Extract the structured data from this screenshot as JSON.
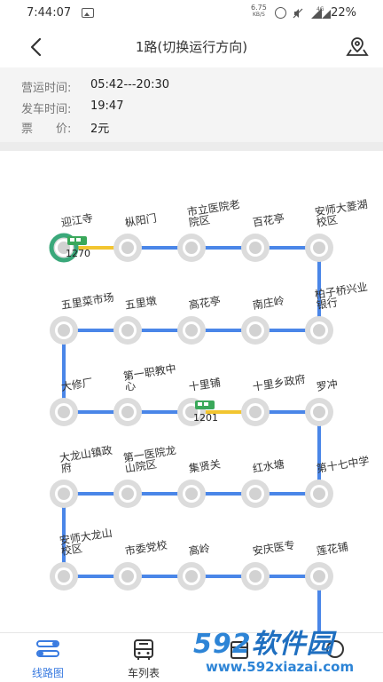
{
  "status_bar": {
    "time": "7:44:07",
    "net_speed": "6.75",
    "net_unit": "KB/S",
    "network": "4G",
    "battery": "22%"
  },
  "header": {
    "title": "1路(切换运行方向)",
    "back_icon": "chevron-left-icon",
    "location_icon": "map-pin-icon"
  },
  "info": {
    "hours_label": "营运时间:",
    "hours_value": "05:42---20:30",
    "depart_label": "发车时间:",
    "depart_value": "19:47",
    "fare_label": "票　　价:",
    "fare_value": "2元"
  },
  "route_map": {
    "colors": {
      "line": "#4a86e8",
      "segment_bus": "#f2c530",
      "start_ring": "#3aa87a",
      "bus": "#3aa85a",
      "node": "#dcdcdc"
    },
    "stations": [
      {
        "name": "迎江寺"
      },
      {
        "name": "枞阳门"
      },
      {
        "name": "市立医院老院区"
      },
      {
        "name": "百花亭"
      },
      {
        "name": "安师大菱湖校区"
      },
      {
        "name": "柏子桥兴业银行"
      },
      {
        "name": "南庄岭"
      },
      {
        "name": "高花亭"
      },
      {
        "name": "五里墩"
      },
      {
        "name": "五里菜市场"
      },
      {
        "name": "大修厂"
      },
      {
        "name": "第一职教中心"
      },
      {
        "name": "十里铺"
      },
      {
        "name": "十里乡政府"
      },
      {
        "name": "罗冲"
      },
      {
        "name": "第十七中学"
      },
      {
        "name": "红水塘"
      },
      {
        "name": "集贤关"
      },
      {
        "name": "第一医院龙山院区"
      },
      {
        "name": "大龙山镇政府"
      },
      {
        "name": "安师大龙山校区"
      },
      {
        "name": "市委党校"
      },
      {
        "name": "高岭"
      },
      {
        "name": "安庆医专"
      },
      {
        "name": "莲花铺"
      }
    ],
    "buses": [
      {
        "label": "1270",
        "station_index": 0
      },
      {
        "label": "1201",
        "station_index": 12
      }
    ]
  },
  "tabs": [
    {
      "label": "线路图",
      "icon": "route-map-icon",
      "active": true
    },
    {
      "label": "车列表",
      "icon": "bus-icon",
      "active": false
    },
    {
      "label": "",
      "icon": "timetable-icon",
      "active": false
    },
    {
      "label": "",
      "icon": "more-icon",
      "active": false
    }
  ],
  "watermark": {
    "brand_num": "592",
    "brand_text": "软件园",
    "url": "www.592xiazai.com"
  }
}
